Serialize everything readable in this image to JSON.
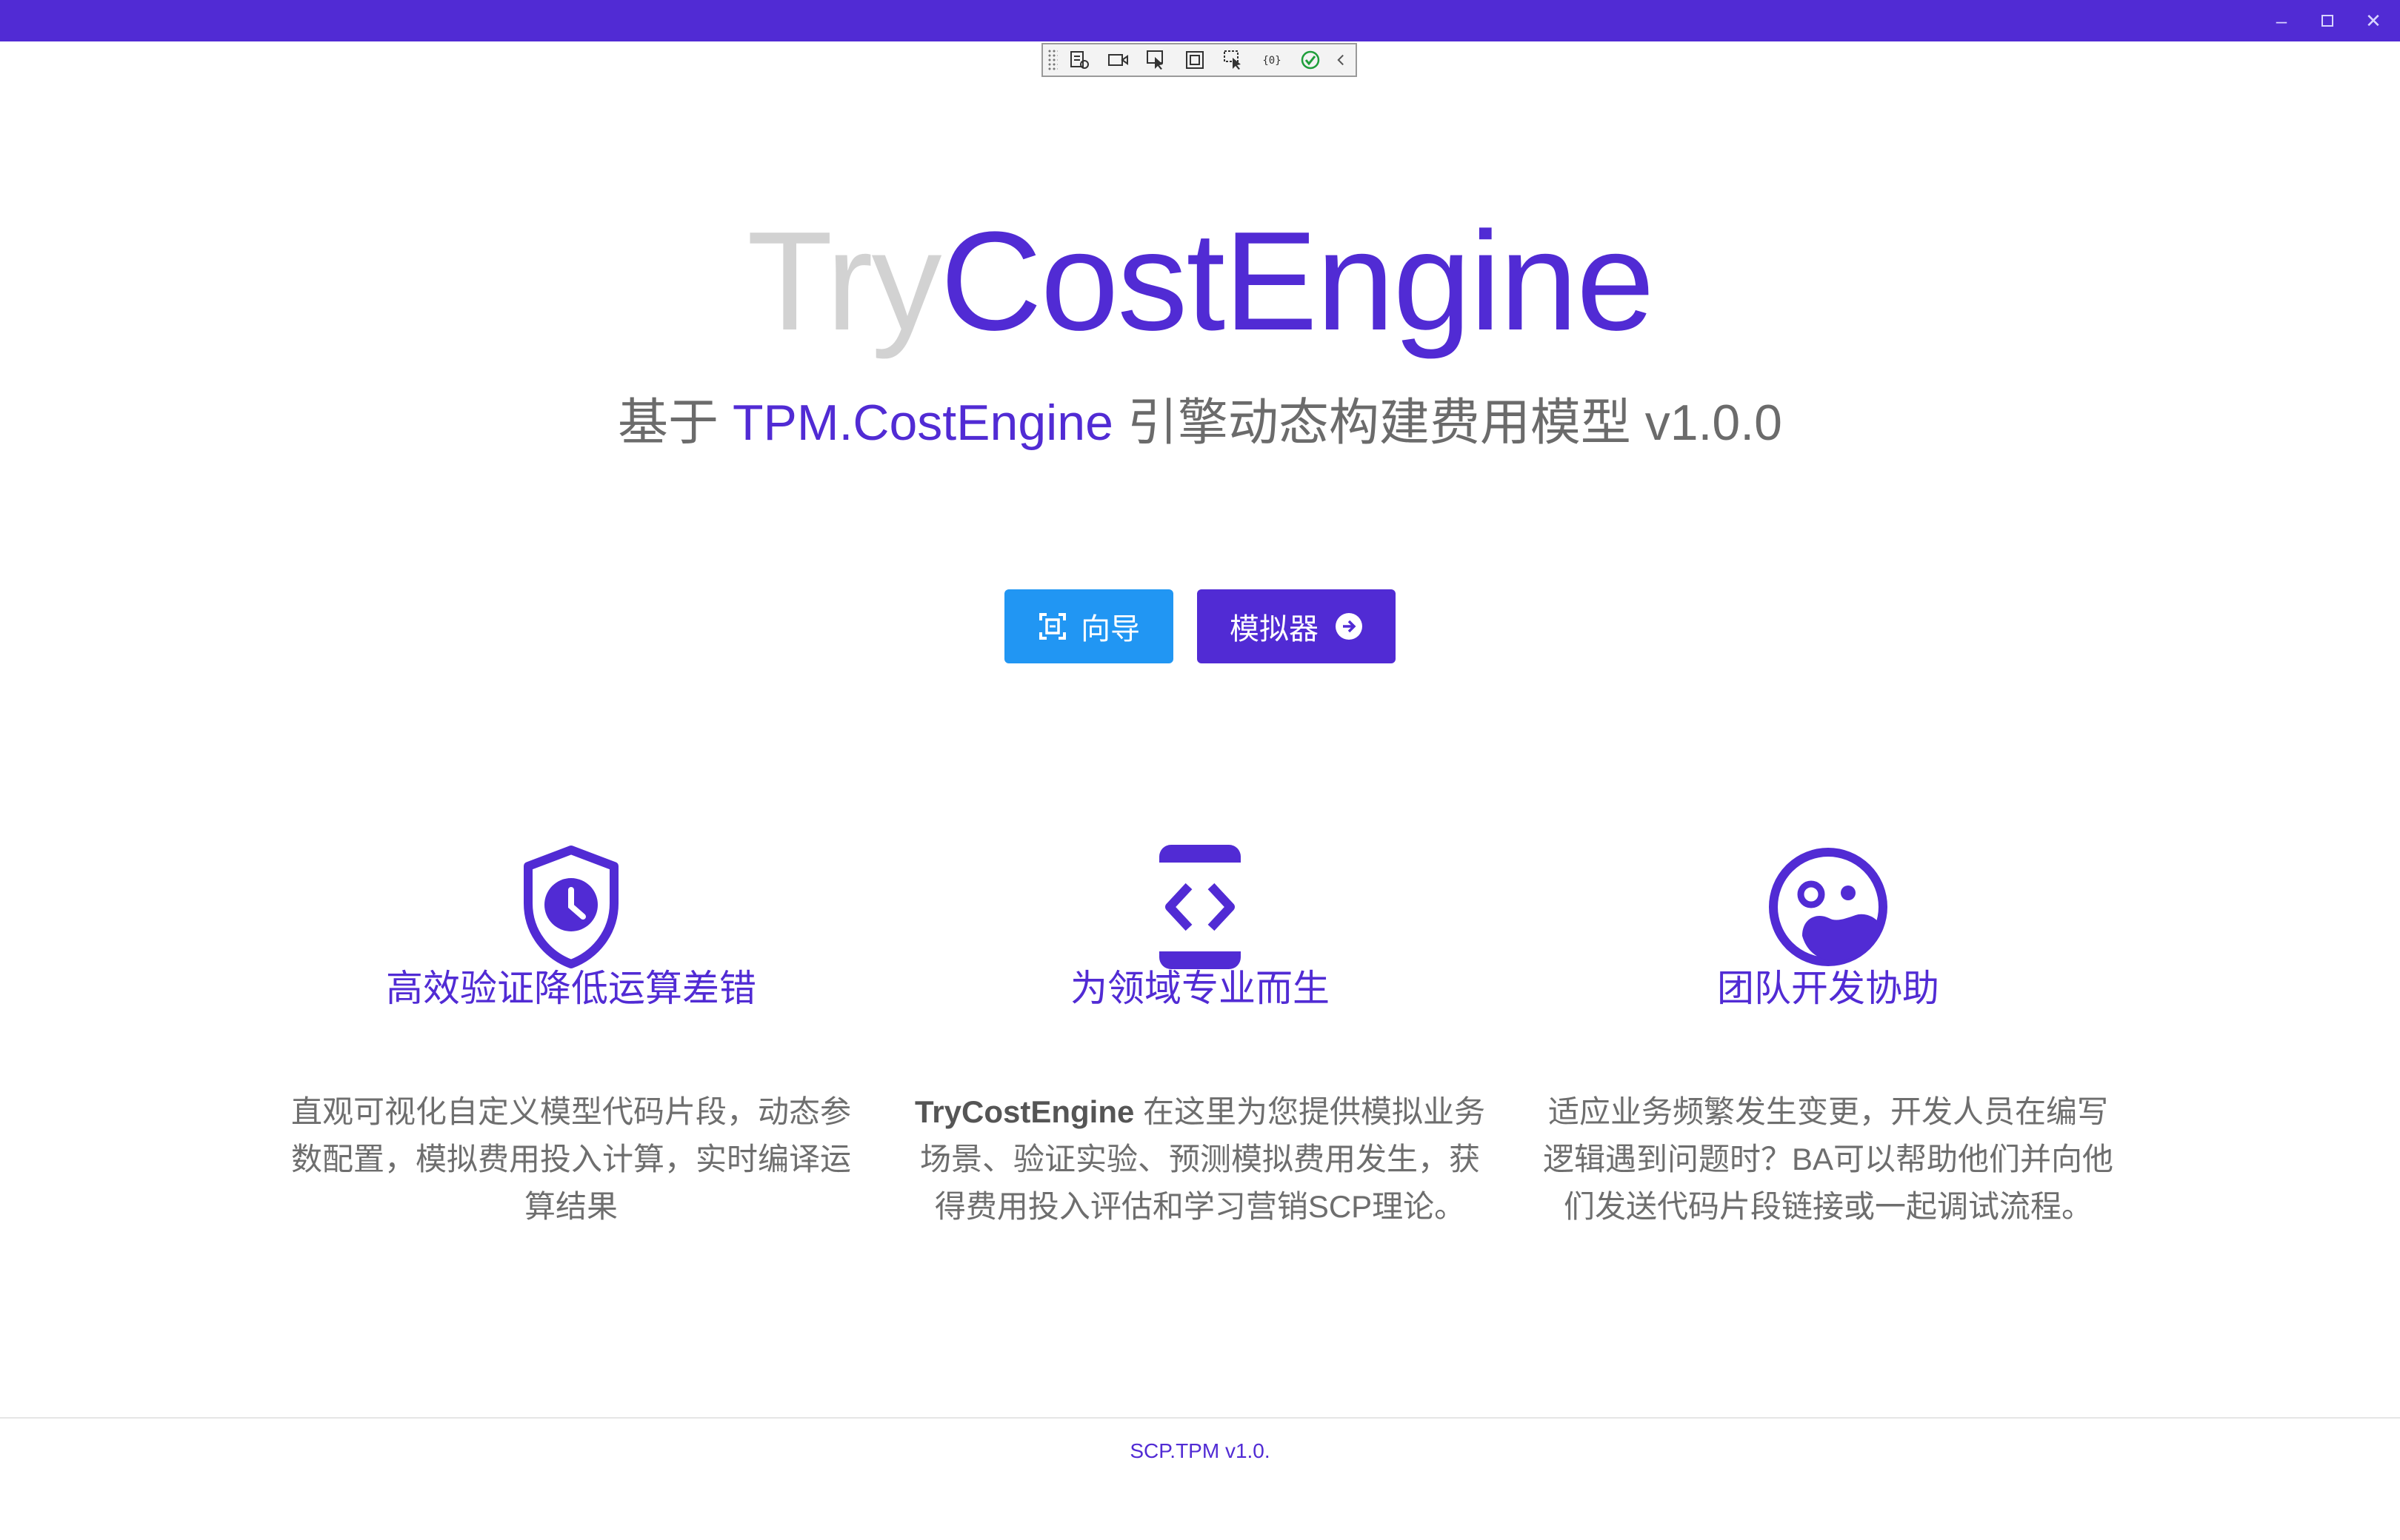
{
  "app": {
    "titlebar_color": "#512bd4",
    "accent": "#512bd4",
    "window_controls": [
      "minimize",
      "maximize",
      "close"
    ]
  },
  "devbar": {
    "tools": [
      "live-visual-tree-icon",
      "record-icon",
      "select-element-icon",
      "display-layout-adorners-icon",
      "track-focus-icon",
      "binding-failures-icon",
      "hot-reload-ok-icon",
      "collapse-icon"
    ]
  },
  "hero": {
    "title_part1": "Try",
    "title_part2": "CostEngine",
    "subtitle_prefix": "基于 ",
    "subtitle_highlight": "TPM.CostEngine",
    "subtitle_suffix": " 引擎动态构建费用模型 v1.0.0"
  },
  "buttons": {
    "guide": {
      "label": "向导",
      "color": "#2196f3",
      "icon": "scan-icon"
    },
    "simulator": {
      "label": "模拟器",
      "color": "#512bd4",
      "icon": "arrow-right-circle-icon"
    }
  },
  "features": [
    {
      "icon": "shield-clock-icon",
      "title": "高效验证降低运算差错",
      "desc": "直观可视化自定义模型代码片段，动态参数配置，模拟费用投入计算，实时编译运算结果"
    },
    {
      "icon": "code-device-icon",
      "title": "为领域专业而生",
      "desc_bold": "TryCostEngine",
      "desc": " 在这里为您提供模拟业务场景、验证实验、预测模拟费用发生，获得费用投入评估和学习营销SCP理论。"
    },
    {
      "icon": "team-face-icon",
      "title": "团队开发协助",
      "desc": "适应业务频繁发生变更，开发人员在编写逻辑遇到问题时？BA可以帮助他们并向他们发送代码片段链接或一起调试流程。"
    }
  ],
  "footer": {
    "text": "SCP.TPM v1.0."
  }
}
